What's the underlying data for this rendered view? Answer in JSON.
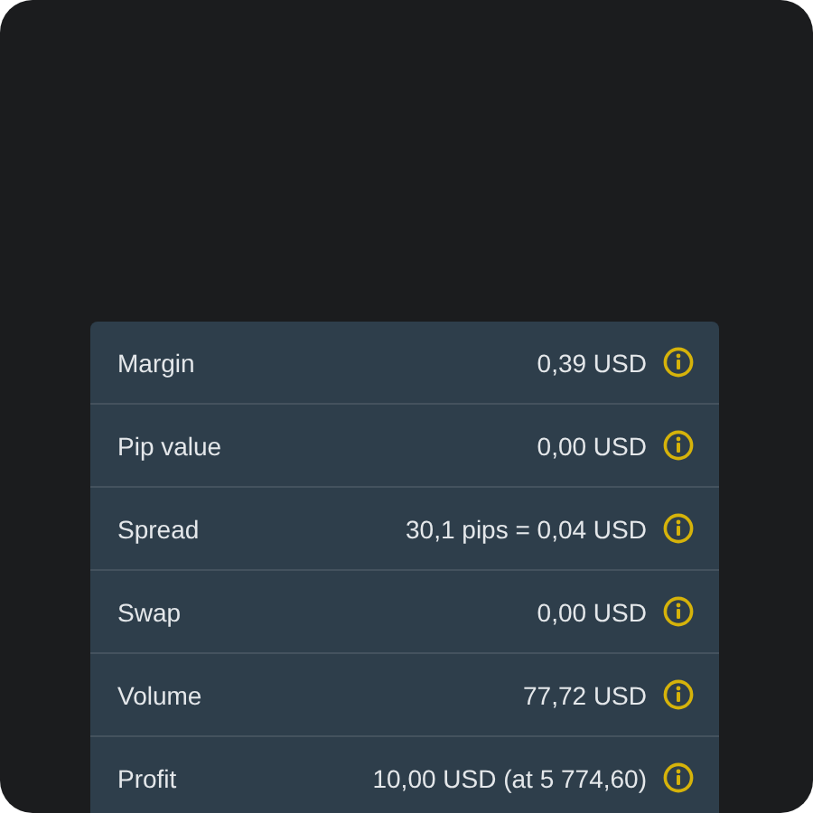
{
  "details": [
    {
      "label": "Margin",
      "value": "0,39 USD"
    },
    {
      "label": "Pip value",
      "value": "0,00 USD"
    },
    {
      "label": "Spread",
      "value": "30,1 pips = 0,04 USD"
    },
    {
      "label": "Swap",
      "value": "0,00 USD"
    },
    {
      "label": "Volume",
      "value": "77,72 USD"
    },
    {
      "label": "Profit",
      "value": "10,00 USD (at 5 774,60)"
    }
  ]
}
